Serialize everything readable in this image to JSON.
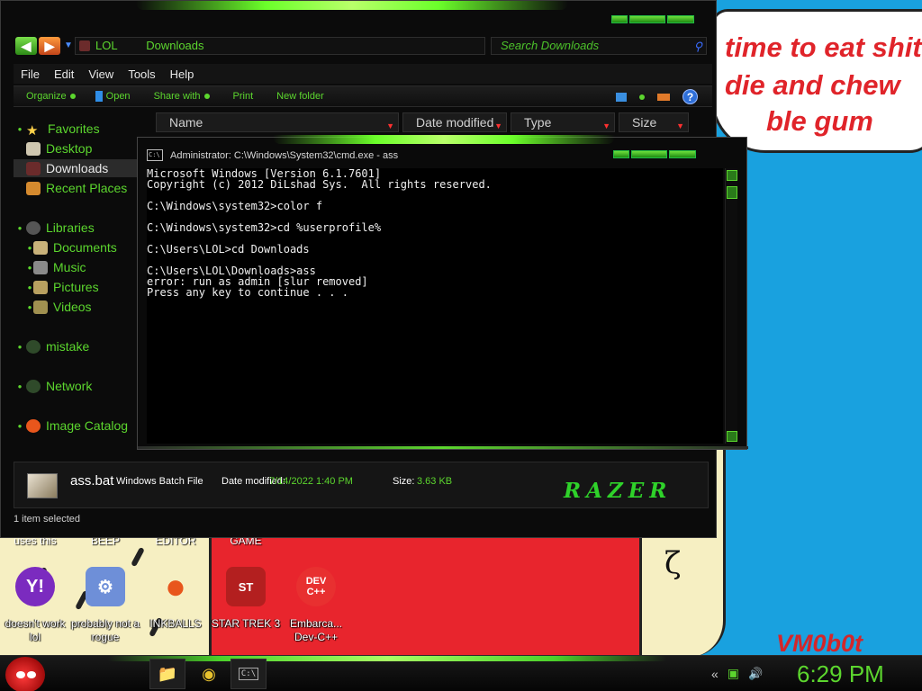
{
  "wallpaper": {
    "bubble_lines": [
      "time to eat shit",
      "die and chew",
      "ble gum"
    ],
    "signature": "VM0b0t",
    "curl_glyph": "ζ"
  },
  "desktop": {
    "top_labels": [
      "uses this",
      "BEEP",
      "EDITOR",
      "GAME"
    ],
    "icons": [
      {
        "name": "yahoo-messenger-icon",
        "glyph": "Y!",
        "color": "#7b2bbf",
        "label": "doesn't work lol"
      },
      {
        "name": "rogue-program-icon",
        "glyph": "⚙",
        "color": "#6e8fd8",
        "label": "probably not a rogue"
      },
      {
        "name": "inkball-icon",
        "glyph": "●",
        "color": "#e8561c",
        "label": "INKBALLS"
      },
      {
        "name": "star-trek-icon",
        "glyph": "ST",
        "color": "#b31f1f",
        "label": "STAR TREK 3"
      },
      {
        "name": "dev-cpp-icon",
        "glyph": "DEV C++",
        "color": "#e83030",
        "label": "Embarca... Dev-C++"
      }
    ]
  },
  "explorer": {
    "address": {
      "crumbs": [
        "LOL",
        "Downloads"
      ]
    },
    "search_placeholder": "Search Downloads",
    "menu": [
      "File",
      "Edit",
      "View",
      "Tools",
      "Help"
    ],
    "commands": {
      "organize": "Organize",
      "open": "Open",
      "share": "Share with",
      "print": "Print",
      "new_folder": "New folder"
    },
    "help_glyph": "?",
    "nav": {
      "favorites": "Favorites",
      "desktop": "Desktop",
      "downloads": "Downloads",
      "recent": "Recent Places",
      "libraries": "Libraries",
      "documents": "Documents",
      "music": "Music",
      "pictures": "Pictures",
      "videos": "Videos",
      "mistake": "mistake",
      "network": "Network",
      "image_catalog": "Image Catalog"
    },
    "columns": [
      "Name",
      "Date modified",
      "Type",
      "Size"
    ],
    "details": {
      "file_name": "ass.bat",
      "file_type": "Windows Batch File",
      "date_label": "Date modified:",
      "date_value": "7/14/2022 1:40 PM",
      "size_label": "Size:",
      "size_value": "3.63 KB",
      "brand": "RAZER"
    },
    "status": "1 item selected"
  },
  "cmd": {
    "title": "Administrator: C:\\Windows\\System32\\cmd.exe - ass",
    "icon_text": "C:\\",
    "lines": [
      "Microsoft Windows [Version 6.1.7601]",
      "Copyright (c) 2012 DiLshad Sys.  All rights reserved.",
      "",
      "C:\\Windows\\system32>color f",
      "",
      "C:\\Windows\\system32>cd %userprofile%",
      "",
      "C:\\Users\\LOL>cd Downloads",
      "",
      "C:\\Users\\LOL\\Downloads>ass",
      "error: run as admin [slur removed]",
      "Press any key to continue . . ."
    ]
  },
  "taskbar": {
    "pinned": [
      {
        "name": "explorer-taskbar-icon",
        "glyph": "📁"
      },
      {
        "name": "chrome-taskbar-icon",
        "glyph": "◉"
      },
      {
        "name": "cmd-taskbar-icon",
        "glyph": "C:\\"
      }
    ],
    "tray": {
      "chevron": "«",
      "net": "▣",
      "volume": "🔊"
    },
    "clock": "6:29 PM"
  },
  "colors": {
    "accent": "#5cd62e",
    "cmd_bg": "#000000",
    "wallpaper": "#19a1df"
  }
}
